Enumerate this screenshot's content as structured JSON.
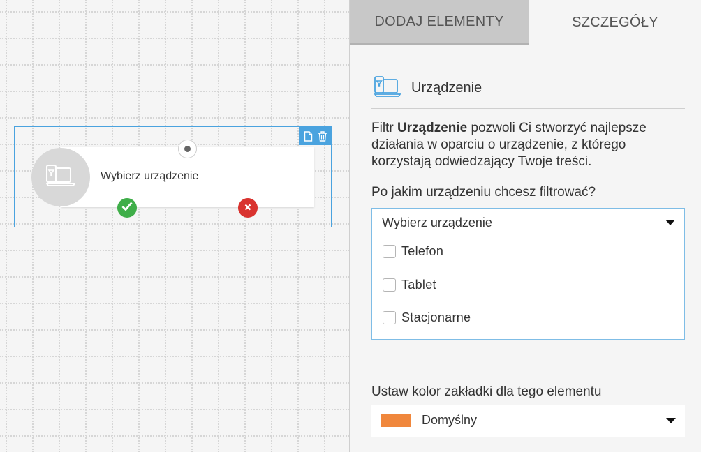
{
  "tabs": {
    "add_elements": "DODAJ ELEMENTY",
    "details": "SZCZEGÓŁY"
  },
  "node": {
    "label": "Wybierz urządzenie",
    "icon": "device-icon",
    "toolbar_icons": [
      "copy-icon",
      "trash-icon"
    ]
  },
  "details": {
    "title": "Urządzenie",
    "icon": "device-icon",
    "description_prefix": "Filtr ",
    "description_bold": "Urządzenie",
    "description_suffix": " pozwoli Ci stworzyć najlepsze działania w oparciu o urządzenie, z którego korzystają odwiedzający Twoje treści.",
    "question": "Po jakim urządzeniu chcesz filtrować?",
    "device_select": {
      "value": "Wybierz urządzenie",
      "options": [
        "Telefon",
        "Tablet",
        "Stacjonarne"
      ]
    },
    "color_label": "Ustaw kolor zakładki dla tego elementu",
    "color_select": {
      "value": "Domyślny",
      "swatch": "#f0873c"
    }
  },
  "colors": {
    "accent": "#4aa3df",
    "yes": "#3fae49",
    "no": "#d9332f"
  }
}
